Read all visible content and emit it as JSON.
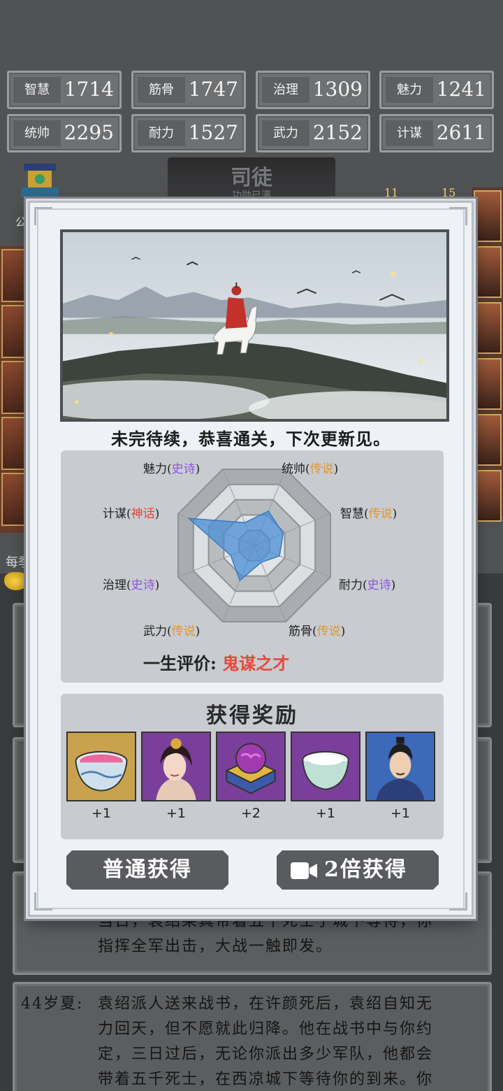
{
  "stats": [
    {
      "label": "智慧",
      "value": "1714"
    },
    {
      "label": "筋骨",
      "value": "1747"
    },
    {
      "label": "治理",
      "value": "1309"
    },
    {
      "label": "魅力",
      "value": "1241"
    },
    {
      "label": "统帅",
      "value": "2295"
    },
    {
      "label": "耐力",
      "value": "1527"
    },
    {
      "label": "武力",
      "value": "2152"
    },
    {
      "label": "计谋",
      "value": "2611"
    }
  ],
  "title_banner": {
    "title": "司徒",
    "subtitle": "功勋已满"
  },
  "side": {
    "left_text": "每季",
    "left_label": "公",
    "badges": [
      "11",
      "15"
    ]
  },
  "log_entries": [
    {
      "age": "",
      "lines": [
        "当日，袁绍果真带着五千死士于城下等待，你",
        "指挥全军出击，大战一触即发。"
      ]
    },
    {
      "age": "44岁夏:",
      "lines": [
        "袁绍派人送来战书，在许颜死后，袁绍自知无",
        "力回天，但不愿就此归降。他在战书中与你约",
        "定，三日过后，无论你派出多少军队，他都会",
        "带着五千死士，在西凉城下等待你的到来。你"
      ]
    }
  ],
  "modal": {
    "end_message": "未完待续，恭喜通关，下次更新见。",
    "radar": {
      "axes": [
        {
          "name": "统帅",
          "quality": "传说",
          "tier": "legend"
        },
        {
          "name": "智慧",
          "quality": "传说",
          "tier": "legend"
        },
        {
          "name": "耐力",
          "quality": "史诗",
          "tier": "epic"
        },
        {
          "name": "筋骨",
          "quality": "传说",
          "tier": "legend"
        },
        {
          "name": "武力",
          "quality": "传说",
          "tier": "legend"
        },
        {
          "name": "治理",
          "quality": "史诗",
          "tier": "epic"
        },
        {
          "name": "计谋",
          "quality": "神话",
          "tier": "myth"
        },
        {
          "name": "魅力",
          "quality": "史诗",
          "tier": "epic"
        }
      ],
      "values": [
        0.45,
        0.38,
        0.33,
        0.22,
        0.46,
        0.31,
        0.86,
        0.3
      ]
    },
    "life_eval": {
      "label": "一生评价:",
      "value": "鬼谋之才"
    },
    "rewards": {
      "title": "获得奖励",
      "items": [
        {
          "icon": "pink-potion-bowl-icon",
          "count": "+1"
        },
        {
          "icon": "beauty-portrait-icon",
          "count": "+1"
        },
        {
          "icon": "purple-gem-chest-icon",
          "count": "+2"
        },
        {
          "icon": "white-bowl-icon",
          "count": "+1"
        },
        {
          "icon": "general-portrait-icon",
          "count": "+1"
        }
      ]
    },
    "buttons": {
      "normal": "普通获得",
      "double": "2倍获得"
    }
  },
  "colors": {
    "epic": "#8e56e0",
    "legend": "#e4962a",
    "myth": "#e2453a",
    "radar_fill": "#4a8ed6"
  }
}
